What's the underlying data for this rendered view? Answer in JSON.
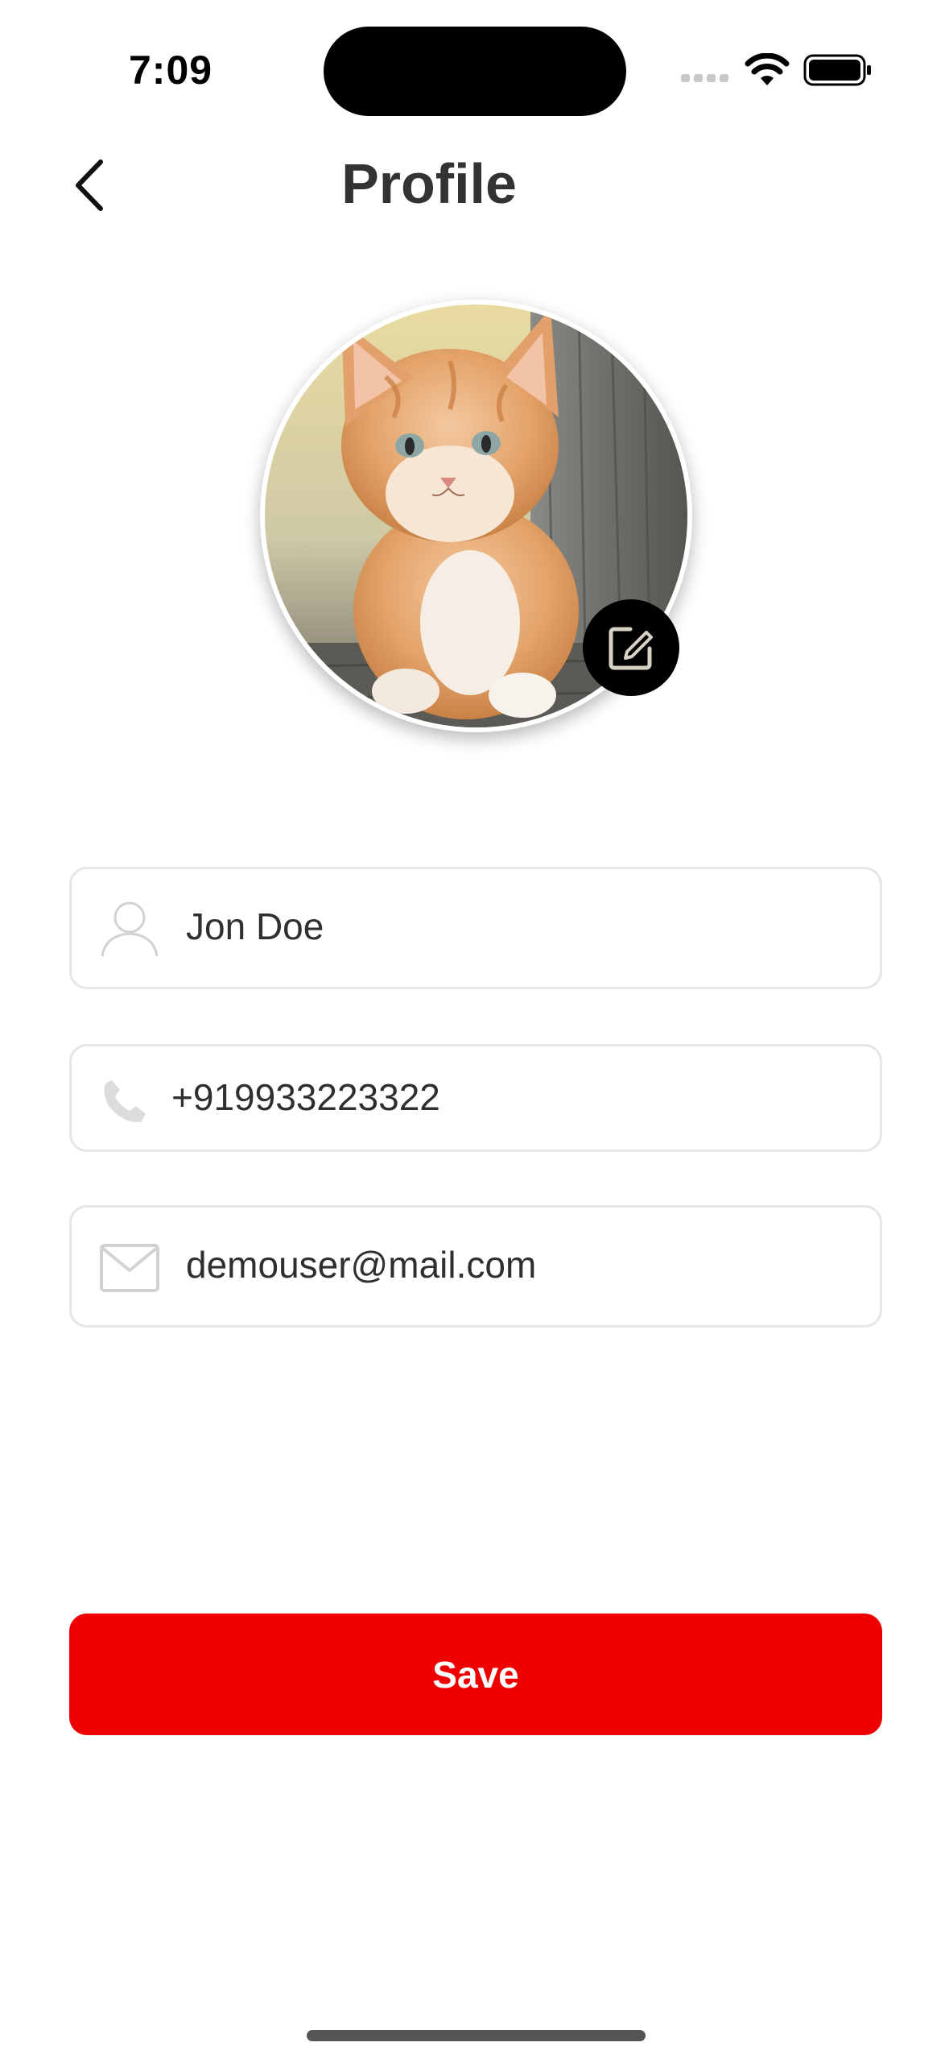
{
  "status_bar": {
    "time": "7:09"
  },
  "header": {
    "title": "Profile",
    "back_icon": "chevron-left-icon"
  },
  "avatar": {
    "image": "orange kitten photo",
    "edit_icon": "edit-square-icon"
  },
  "fields": {
    "name": {
      "value": "Jon Doe",
      "icon": "person-icon"
    },
    "phone": {
      "value": "+919933223322",
      "icon": "phone-icon"
    },
    "email": {
      "value": "demouser@mail.com",
      "icon": "mail-icon"
    }
  },
  "actions": {
    "save_label": "Save"
  },
  "colors": {
    "accent": "#ee0000",
    "field_border": "#e6e6e6",
    "icon_gray": "#cfcfcf"
  }
}
